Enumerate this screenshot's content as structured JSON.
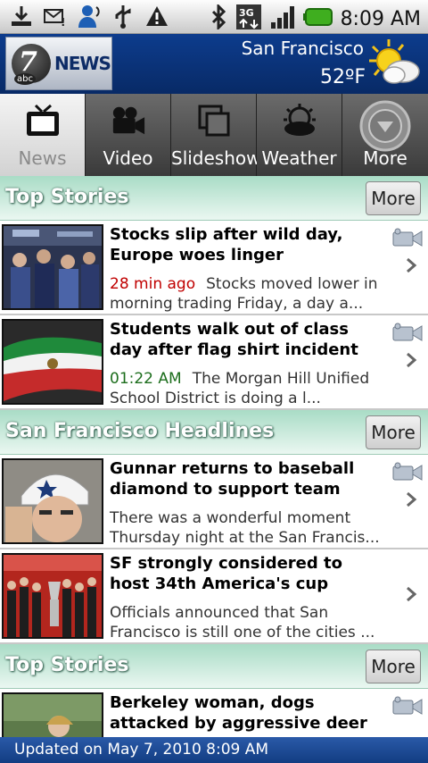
{
  "status_bar": {
    "time": "8:09 AM"
  },
  "header": {
    "logo_text": "NEWS",
    "logo_numeral": "7",
    "logo_abc": "abc",
    "city": "San Francisco",
    "temperature": "52ºF"
  },
  "tabs": [
    {
      "label": "News",
      "icon": "tv-icon",
      "active": true
    },
    {
      "label": "Video",
      "icon": "video-camera-icon",
      "active": false
    },
    {
      "label": "Slideshow",
      "icon": "slideshow-icon",
      "active": false
    },
    {
      "label": "Weather",
      "icon": "weather-icon",
      "active": false
    },
    {
      "label": "More",
      "icon": "chevron-down-icon",
      "active": false
    }
  ],
  "sections": [
    {
      "title": "Top Stories",
      "more_label": "More",
      "stories": [
        {
          "headline": "Stocks slip after wild day, Europe woes linger",
          "time": "28 min ago",
          "blurb": "Stocks moved lower in morning trading Friday, a day a..."
        },
        {
          "headline": "Students walk out of class day after flag shirt incident",
          "time": "01:22 AM",
          "blurb": "The Morgan Hill Unified School District is doing a l..."
        }
      ]
    },
    {
      "title": "San Francisco Headlines",
      "more_label": "More",
      "stories": [
        {
          "headline": "Gunnar returns to baseball diamond to support team",
          "blurb": "There was a wonderful moment Thursday night at the San Francis..."
        },
        {
          "headline": "SF strongly considered to host 34th America's cup",
          "blurb": "Officials announced that San Francisco is still one of the cities ..."
        }
      ]
    },
    {
      "title": "Top Stories",
      "more_label": "More",
      "stories": [
        {
          "headline": "Berkeley woman, dogs attacked by aggressive deer",
          "blurb": ""
        }
      ]
    }
  ],
  "footer": {
    "updated": "Updated on May 7, 2010 8:09 AM"
  },
  "colors": {
    "header_blue": "#0d3c8d",
    "section_green": "#a9dcc6",
    "time_red": "#c00000",
    "time_green": "#1d6e1d"
  }
}
